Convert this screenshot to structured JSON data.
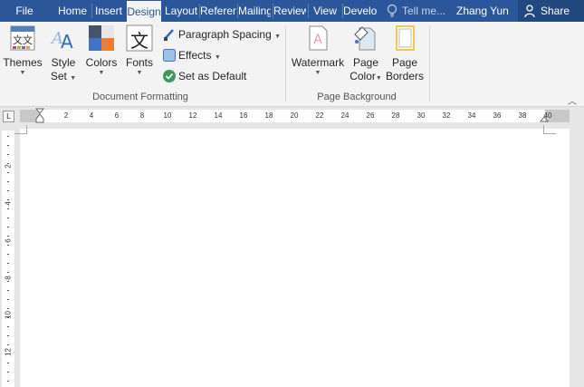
{
  "tabs": [
    {
      "label": "File",
      "active": false
    },
    {
      "label": "Home",
      "active": false
    },
    {
      "label": "Insert",
      "active": false
    },
    {
      "label": "Design",
      "active": true
    },
    {
      "label": "Layout",
      "active": false
    },
    {
      "label": "References",
      "active": false
    },
    {
      "label": "Mailings",
      "active": false
    },
    {
      "label": "Review",
      "active": false
    },
    {
      "label": "View",
      "active": false
    },
    {
      "label": "Developer",
      "active": false
    }
  ],
  "tell_me": "Tell me...",
  "user_name": "Zhang Yun",
  "share_label": "Share",
  "ribbon": {
    "document_formatting": {
      "group_label": "Document Formatting",
      "themes_label": "Themes",
      "style_set_label1": "Style",
      "style_set_label2": "Set",
      "colors_label": "Colors",
      "fonts_label": "Fonts",
      "fonts_glyph": "文",
      "paragraph_spacing_label": "Paragraph Spacing",
      "effects_label": "Effects",
      "set_default_label": "Set as Default"
    },
    "page_background": {
      "group_label": "Page Background",
      "watermark_label": "Watermark",
      "page_color_label1": "Page",
      "page_color_label2": "Color",
      "page_borders_label1": "Page",
      "page_borders_label2": "Borders"
    }
  },
  "ruler": {
    "horizontal_ticks": [
      "2",
      "4",
      "6",
      "8",
      "10",
      "12",
      "14",
      "16",
      "18",
      "20",
      "22",
      "24",
      "26",
      "28",
      "30",
      "32",
      "34",
      "36",
      "38",
      "40"
    ],
    "vertical_ticks": [
      "2",
      "4",
      "6",
      "8",
      "10",
      "12"
    ],
    "corner_glyph": "L"
  },
  "colors": {
    "title_bar": "#2b579a",
    "ribbon_bg": "#f3f3f3",
    "canvas_bg": "#e6e6e6"
  }
}
